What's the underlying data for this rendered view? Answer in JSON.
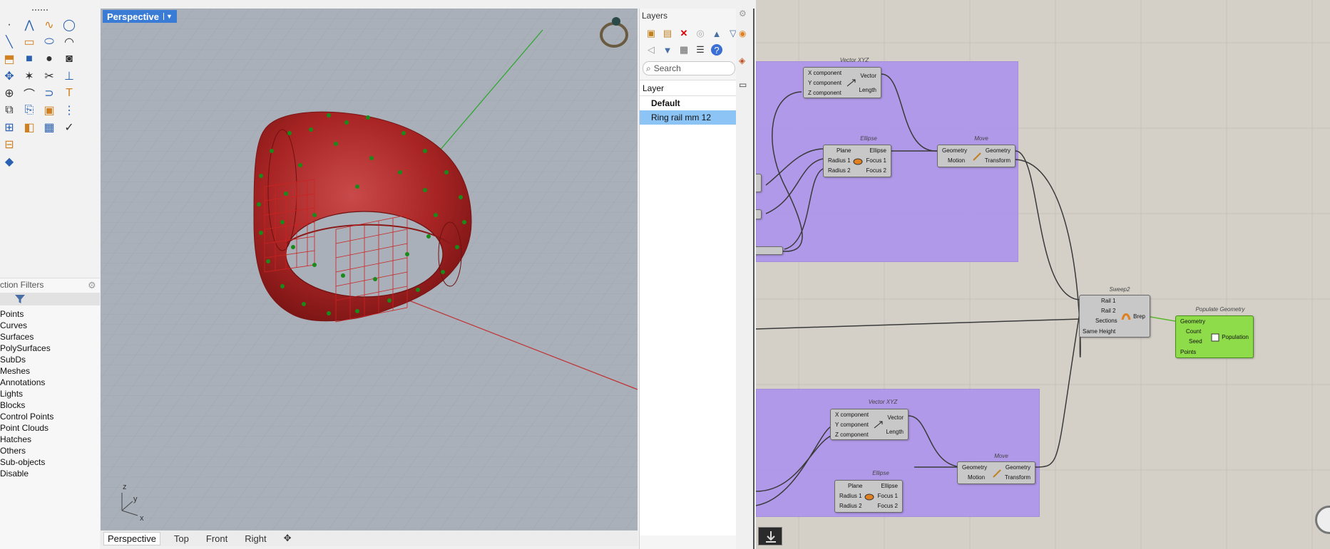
{
  "toolbar": {
    "tools": [
      [
        "point-icon",
        "polyline-icon",
        "curve-icon",
        "circle-icon"
      ],
      [
        "line-icon",
        "rectangle-icon",
        "ellipse-icon",
        "arc-icon"
      ],
      [
        "extrude-icon",
        "box-icon",
        "sphere-icon",
        "cylinder-icon"
      ],
      [
        "transform-icon",
        "explode-icon",
        "trim-icon",
        "split-icon"
      ],
      [
        "dimension-icon",
        "fillet-icon",
        "join-icon",
        "text-icon"
      ],
      [
        "group-icon",
        "copy-icon",
        "block-icon",
        "array-icon"
      ],
      [
        "snap-icon",
        "layer-icon",
        "hatch-icon",
        "check-icon"
      ],
      [
        "properties-icon"
      ],
      [
        "paint-icon"
      ]
    ]
  },
  "filters": {
    "title": "ction Filters",
    "items": [
      "Points",
      "Curves",
      "Surfaces",
      "PolySurfaces",
      "SubDs",
      "Meshes",
      "Annotations",
      "Lights",
      "Blocks",
      "Control Points",
      "Point Clouds",
      "Hatches",
      "Others",
      "Sub-objects",
      "Disable"
    ]
  },
  "viewport": {
    "active_label": "Perspective",
    "tabs": [
      "Perspective",
      "Top",
      "Front",
      "Right"
    ],
    "axes": {
      "x": "x",
      "y": "y",
      "z": "z"
    }
  },
  "layers": {
    "title": "Layers",
    "search_placeholder": "Search",
    "column_header": "Layer",
    "rows": [
      {
        "name": "Default",
        "bold": true,
        "selected": false
      },
      {
        "name": "Ring rail mm 12",
        "bold": false,
        "selected": true
      }
    ]
  },
  "grasshopper": {
    "vector_xyz_1": {
      "title": "Vector XYZ",
      "inputs": [
        "X component",
        "Y component",
        "Z component"
      ],
      "outputs": [
        "Vector",
        "Length"
      ]
    },
    "ellipse_1": {
      "title": "Ellipse",
      "inputs": [
        "Plane",
        "Radius 1",
        "Radius 2"
      ],
      "outputs": [
        "Ellipse",
        "Focus 1",
        "Focus 2"
      ]
    },
    "move_1": {
      "title": "Move",
      "inputs": [
        "Geometry",
        "Motion"
      ],
      "outputs": [
        "Geometry",
        "Transform"
      ]
    },
    "sweep2": {
      "title": "Sweep2",
      "inputs": [
        "Rail 1",
        "Rail 2",
        "Sections",
        "Same Height"
      ],
      "outputs": [
        "Brep"
      ]
    },
    "populate": {
      "title": "Populate Geometry",
      "inputs": [
        "Geometry",
        "Count",
        "Seed",
        "Points"
      ],
      "outputs": [
        "Population"
      ]
    },
    "vector_xyz_2": {
      "title": "Vector XYZ",
      "inputs": [
        "X component",
        "Y component",
        "Z component"
      ],
      "outputs": [
        "Vector",
        "Length"
      ]
    },
    "ellipse_2": {
      "title": "Ellipse",
      "inputs": [
        "Plane",
        "Radius 1",
        "Radius 2"
      ],
      "outputs": [
        "Ellipse",
        "Focus 1",
        "Focus 2"
      ]
    },
    "move_2": {
      "title": "Move",
      "inputs": [
        "Geometry",
        "Motion"
      ],
      "outputs": [
        "Geometry",
        "Transform"
      ]
    }
  },
  "colors": {
    "accent": "#3a7bd5",
    "group": "#aa8cf0",
    "ring": "#b52a2a",
    "points": "#1a8a1a",
    "selection": "#8cc4f5"
  }
}
